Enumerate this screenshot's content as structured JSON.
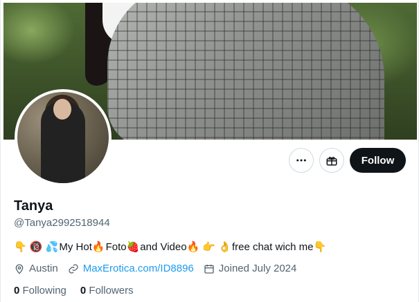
{
  "profile": {
    "name": "Tanya",
    "handle": "@Tanya2992518944",
    "bio": {
      "prefix_emoji": "👇 🔞 💦",
      "part1": "My Hot",
      "emoji1": "🔥",
      "part2": " Foto",
      "emoji2": "🍓",
      "part3": " and Video",
      "emoji3": "🔥 👉 👌",
      "part4": " free chat wich me ",
      "emoji4": "👇"
    },
    "location": "Austin",
    "website": "MaxErotica.com/ID8896",
    "joined": "Joined July 2024",
    "following_count": "0",
    "following_label": "Following",
    "followers_count": "0",
    "followers_label": "Followers"
  },
  "actions": {
    "more_icon": "more-horizontal-icon",
    "subscribe_icon": "gift-icon",
    "follow_label": "Follow"
  },
  "colors": {
    "text": "#0f1419",
    "muted": "#536471",
    "link": "#1d9bf0",
    "follow_bg": "#0f1419"
  }
}
